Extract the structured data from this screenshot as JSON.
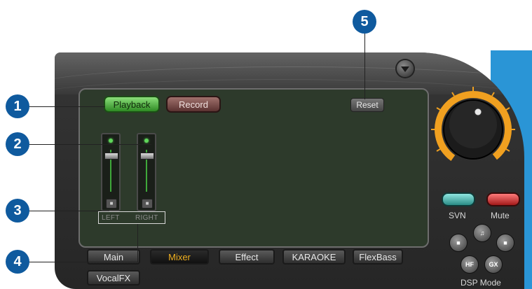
{
  "buttons": {
    "playback": "Playback",
    "record": "Record",
    "reset": "Reset"
  },
  "faders": {
    "left_label": "LEFT",
    "right_label": "RIGHT"
  },
  "tabs": [
    "Main",
    "Mixer",
    "Effect",
    "KARAOKE",
    "FlexBass",
    "VocalFX"
  ],
  "active_tab": "Mixer",
  "controls": {
    "svn_label": "SVN",
    "mute_label": "Mute",
    "dsp_mode_label": "DSP Mode",
    "dsp_buttons": [
      "HF",
      "GX"
    ]
  },
  "callouts": [
    "1",
    "2",
    "3",
    "4",
    "5"
  ],
  "colors": {
    "accent_orange": "#f0a020",
    "callout_blue": "#0f5a9e",
    "playback_green": "#4fbf3a",
    "record_red": "#8a4a46",
    "mute_red": "#e03030",
    "svn_teal": "#5ad0c8"
  }
}
